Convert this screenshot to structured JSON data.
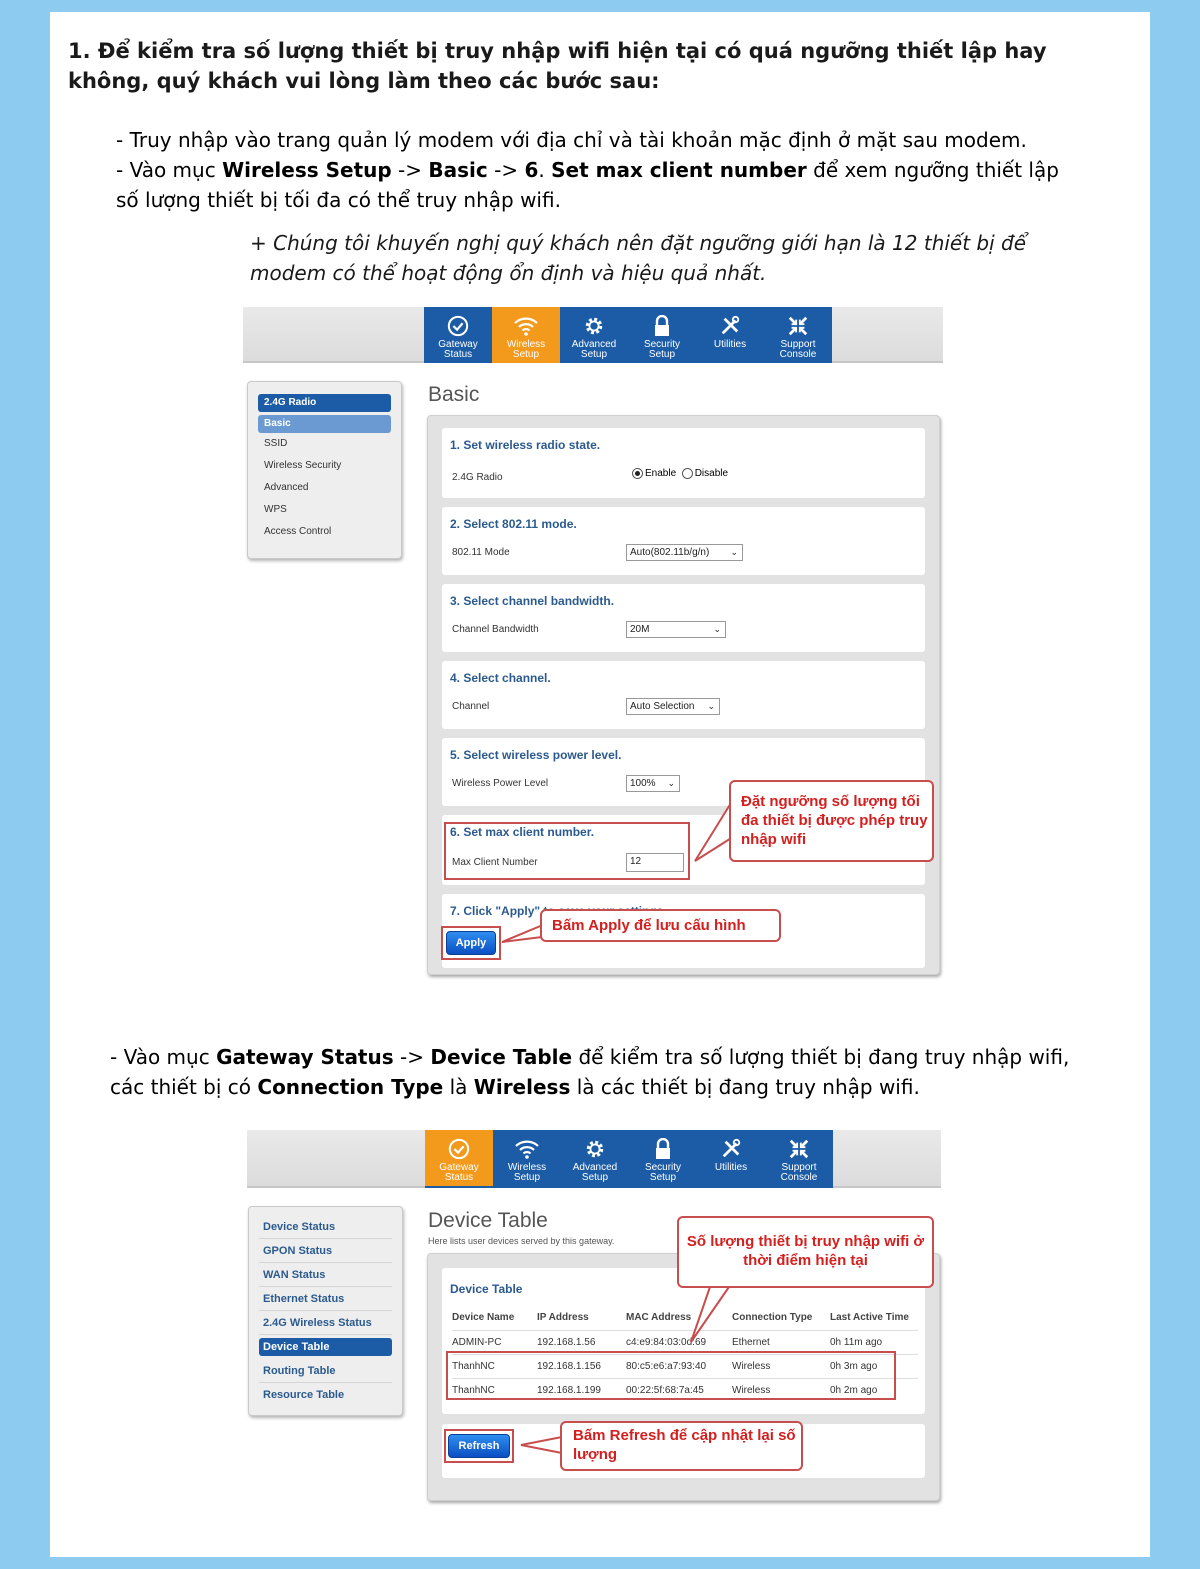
{
  "heading": "1. Để kiểm tra số lượng thiết bị truy nhập wifi hiện tại có quá ngưỡng thiết lập hay không, quý khách vui lòng làm theo các bước sau:",
  "step1": "- Truy nhập vào trang quản lý modem với địa chỉ và tài khoản mặc định ở mặt sau modem.",
  "step2": {
    "pre": "- Vào mục ",
    "b1": "Wireless Setup",
    "mid1": " -> ",
    "b2": "Basic",
    "mid2": " -> ",
    "b3": "6",
    "mid3": ". ",
    "b4": "Set max client number",
    "post": " để xem ngưỡng thiết lập số lượng thiết bị tối đa có thể truy nhập wifi."
  },
  "note": "+ Chúng tôi khuyến nghị quý khách nên đặt ngưỡng giới hạn là 12 thiết bị để modem có thể hoạt động ổn định và hiệu quả nhất.",
  "step3": {
    "pre": "- Vào mục ",
    "b1": "Gateway Status",
    "mid1": " -> ",
    "b2": "Device Table",
    "mid2": " để kiểm tra số lượng thiết bị đang truy nhập wifi, các thiết bị có ",
    "b3": "Connection Type",
    "mid3": " là ",
    "b4": "Wireless",
    "post": " là các thiết bị đang truy nhập wifi."
  },
  "nav": [
    {
      "l1": "Gateway",
      "l2": "Status",
      "icon": "check-circle-icon"
    },
    {
      "l1": "Wireless",
      "l2": "Setup",
      "icon": "wifi-icon"
    },
    {
      "l1": "Advanced",
      "l2": "Setup",
      "icon": "gear-icon"
    },
    {
      "l1": "Security",
      "l2": "Setup",
      "icon": "lock-icon"
    },
    {
      "l1": "Utilities",
      "l2": "",
      "icon": "tools-icon"
    },
    {
      "l1": "Support",
      "l2": "Console",
      "icon": "arrows-icon"
    }
  ],
  "shot1": {
    "sidebar": [
      "2.4G Radio",
      "Basic",
      "SSID",
      "Wireless Security",
      "Advanced",
      "WPS",
      "Access Control"
    ],
    "title": "Basic",
    "s1": {
      "title": "1. Set wireless radio state.",
      "label": "2.4G Radio",
      "enable": "Enable",
      "disable": "Disable"
    },
    "s2": {
      "title": "2. Select 802.11 mode.",
      "label": "802.11 Mode",
      "value": "Auto(802.11b/g/n)"
    },
    "s3": {
      "title": "3. Select channel bandwidth.",
      "label": "Channel Bandwidth",
      "value": "20M"
    },
    "s4": {
      "title": "4. Select channel.",
      "label": "Channel",
      "value": "Auto Selection"
    },
    "s5": {
      "title": "5. Select wireless power level.",
      "label": "Wireless Power Level",
      "value": "100%"
    },
    "s6": {
      "title": "6. Set max client number.",
      "label": "Max Client Number",
      "value": "12"
    },
    "s7": {
      "title": "7. Click \"Apply\" to save your settings.",
      "button": "Apply"
    },
    "callout1": "Đặt ngưỡng số lượng tối đa thiết bị được phép truy nhập wifi",
    "callout2": "Bấm Apply để lưu cấu hình"
  },
  "shot2": {
    "sidebar": [
      "Device Status",
      "GPON Status",
      "WAN Status",
      "Ethernet Status",
      "2.4G Wireless Status",
      "Device Table",
      "Routing Table",
      "Resource Table"
    ],
    "title": "Device Table",
    "subtitle": "Here lists user devices served by this gateway.",
    "card_title": "Device Table",
    "columns": [
      "Device Name",
      "IP Address",
      "MAC Address",
      "Connection Type",
      "Last Active Time"
    ],
    "rows": [
      [
        "ADMIN-PC",
        "192.168.1.56",
        "c4:e9:84:03:0d:69",
        "Ethernet",
        "0h 11m ago"
      ],
      [
        "ThanhNC",
        "192.168.1.156",
        "80:c5:e6:a7:93:40",
        "Wireless",
        "0h 3m ago"
      ],
      [
        "ThanhNC",
        "192.168.1.199",
        "00:22:5f:68:7a:45",
        "Wireless",
        "0h 2m ago"
      ]
    ],
    "button": "Refresh",
    "callout1": "Số lượng thiết bị truy nhập wifi ở thời điểm hiện tại",
    "callout2": "Bấm Refresh để cập nhật lại số lượng"
  }
}
